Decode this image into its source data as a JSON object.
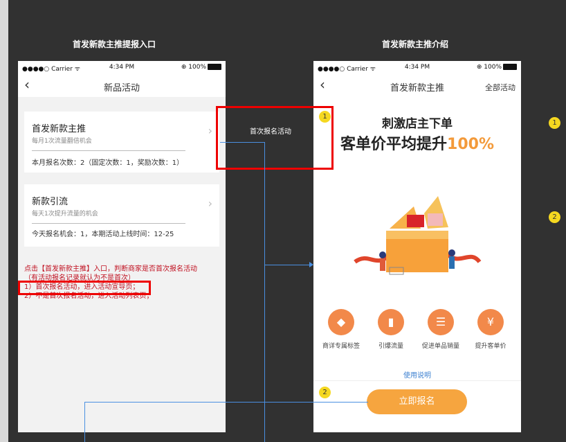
{
  "left_title": "首发新款主推提报入口",
  "right_title": "首发新款主推介绍",
  "left_phone": {
    "status": {
      "carrier": "●●●●○ Carrier ᯤ",
      "time": "4:34 PM",
      "battery": "⊕ 100%"
    },
    "nav_title": "新品活动",
    "card1": {
      "title": "首发新款主推",
      "subtitle": "每月1次流量翻倍机会",
      "footer": "本月报名次数：2（固定次数：1，奖励次数：1）"
    },
    "card2": {
      "title": "新款引流",
      "subtitle": "每天1次提升流量的机会",
      "footer": "今天报名机会：1，本期活动上线时间：12-25"
    },
    "notes": [
      "点击【首发新款主推】入口，判断商家是否首次报名活动",
      "（有活动报名记录就认为不是首次）",
      "1）首次报名活动，进入活动宣导页；",
      "2）不是首次报名活动，进入活动列表页；"
    ]
  },
  "annotation_label": "首次报名活动",
  "right_phone": {
    "status": {
      "carrier": "●●●●○ Carrier ᯤ",
      "time": "4:34 PM",
      "battery": "⊕ 100%"
    },
    "nav_title": "首发新款主推",
    "nav_right": "全部活动",
    "headline1": "刺激店主下单",
    "headline2": "客单价平均提升",
    "headline2_pct": "100%",
    "features": [
      {
        "icon": "tag-icon",
        "glyph": "◆",
        "label": "商详专属标签"
      },
      {
        "icon": "chart-icon",
        "glyph": "▮",
        "label": "引爆流量"
      },
      {
        "icon": "coins-icon",
        "glyph": "☰",
        "label": "促进单品销量"
      },
      {
        "icon": "yen-bag-icon",
        "glyph": "¥",
        "label": "提升客单价"
      }
    ],
    "usage_link": "使用说明",
    "cta": "立即报名"
  },
  "badges": {
    "b1": "1",
    "b2": "2"
  },
  "colors": {
    "accent": "#f6a53f",
    "highlight": "#e00000",
    "link": "#4a90e2",
    "badge": "#f5d820"
  }
}
